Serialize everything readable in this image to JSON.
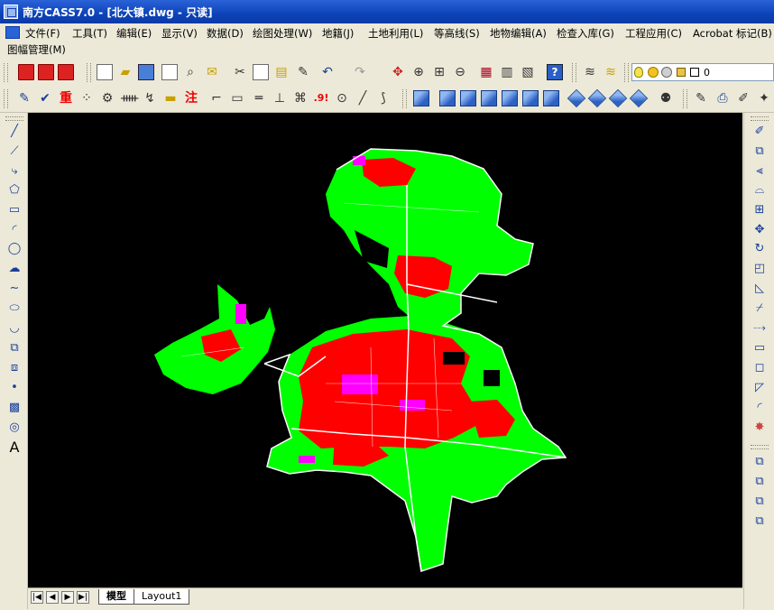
{
  "window": {
    "title": "南方CASS7.0 - [北大镇.dwg - 只读]"
  },
  "menu": {
    "row1": [
      "文件(F)",
      "工具(T)",
      "编辑(E)",
      "显示(V)",
      "数据(D)",
      "绘图处理(W)",
      "地籍(J)",
      "土地利用(L)",
      "等高线(S)",
      "地物编辑(A)",
      "检查入库(G)",
      "工程应用(C)",
      "Acrobat 标记(B)"
    ],
    "row2": [
      "图幅管理(M)"
    ]
  },
  "toolbar1": {
    "icons": [
      "pdf-icon",
      "pdf-convert-icon",
      "pdf-options-icon",
      "new-icon",
      "open-icon",
      "save-icon",
      "plot-icon",
      "preview-icon",
      "publish-icon",
      "cut-icon",
      "copy-icon",
      "paste-icon",
      "match-properties-icon",
      "undo-icon",
      "redo-icon",
      "pan-icon",
      "zoom-realtime-icon",
      "zoom-window-icon",
      "zoom-previous-icon",
      "properties-icon",
      "design-center-icon",
      "tool-palette-icon",
      "help-icon",
      "layer-manager-icon",
      "layer-previous-icon"
    ],
    "layer_value": "0",
    "help_label": "?"
  },
  "toolbar2": {
    "text_buttons": {
      "zhong": "重",
      "zhu": "注",
      "nine": ".9!"
    }
  },
  "tabs": {
    "model": "模型",
    "layout1": "Layout1"
  },
  "nav_buttons": [
    "|◀",
    "◀",
    "▶",
    "▶|"
  ],
  "colors": {
    "titlebar": "#0d43b8",
    "canvas": "#000000",
    "green": "#00ff00",
    "red": "#ff0000",
    "magenta": "#ff00ff",
    "white": "#ffffff"
  }
}
